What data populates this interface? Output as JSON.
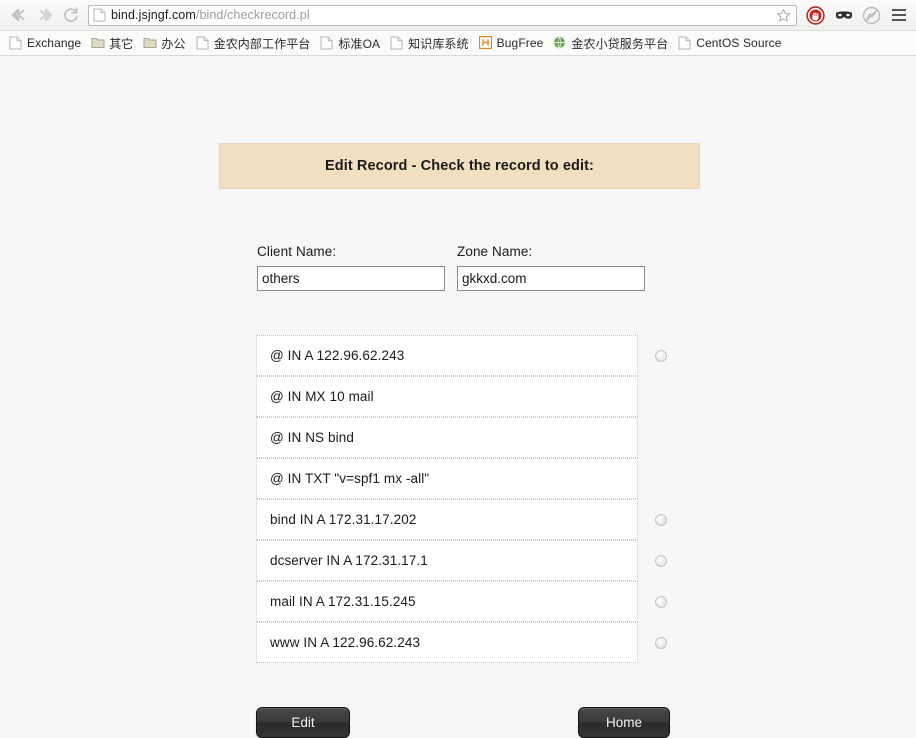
{
  "browser": {
    "back_icon": "back-arrow-icon",
    "forward_icon": "forward-arrow-icon",
    "reload_icon": "reload-icon",
    "url_host": "bind.jsjngf.com",
    "url_path": "/bind/checkrecord.pl",
    "url_full": "bind.jsjngf.com/bind/checkrecord.pl",
    "star_icon": "bookmark-star-icon",
    "extensions": [
      {
        "name": "adblock-icon",
        "color": "#c0261f"
      },
      {
        "name": "mask-icon",
        "color": "#2b2b2b"
      },
      {
        "name": "noscript-icon",
        "color": "#b5b5b5"
      }
    ],
    "menu_icon": "hamburger-menu-icon",
    "bookmarks": [
      {
        "label": "Exchange",
        "icon": "page-icon"
      },
      {
        "label": "其它",
        "icon": "folder-icon"
      },
      {
        "label": "办公",
        "icon": "folder-icon"
      },
      {
        "label": "金农内部工作平台",
        "icon": "page-icon"
      },
      {
        "label": "标准OA",
        "icon": "page-icon"
      },
      {
        "label": "知识库系统",
        "icon": "page-icon"
      },
      {
        "label": "BugFree",
        "icon": "bugfree-favicon"
      },
      {
        "label": "金农小贷服务平台",
        "icon": "green-globe-favicon"
      },
      {
        "label": "CentOS Source",
        "icon": "page-icon"
      }
    ]
  },
  "page": {
    "banner_text": "Edit Record - Check the record to edit:",
    "banner_bg": "#f2dfbf",
    "background": "#f7f7f7",
    "client": {
      "label": "Client Name:",
      "value": "others",
      "placeholder": ""
    },
    "zone": {
      "label": "Zone Name:",
      "value": "gkkxd.com",
      "placeholder": ""
    },
    "records": [
      {
        "text": "@ IN A 122.96.62.243",
        "has_radio": true,
        "selected": false
      },
      {
        "text": "@ IN MX 10 mail",
        "has_radio": false,
        "selected": false
      },
      {
        "text": "@ IN NS bind",
        "has_radio": false,
        "selected": false
      },
      {
        "text": "@ IN TXT \"v=spf1 mx -all\"",
        "has_radio": false,
        "selected": false
      },
      {
        "text": "bind IN A 172.31.17.202",
        "has_radio": true,
        "selected": false
      },
      {
        "text": "dcserver IN A 172.31.17.1",
        "has_radio": true,
        "selected": false
      },
      {
        "text": "mail IN A 172.31.15.245",
        "has_radio": true,
        "selected": false
      },
      {
        "text": "www IN A 122.96.62.243",
        "has_radio": true,
        "selected": false
      }
    ],
    "buttons": {
      "edit_label": "Edit",
      "home_label": "Home"
    }
  }
}
